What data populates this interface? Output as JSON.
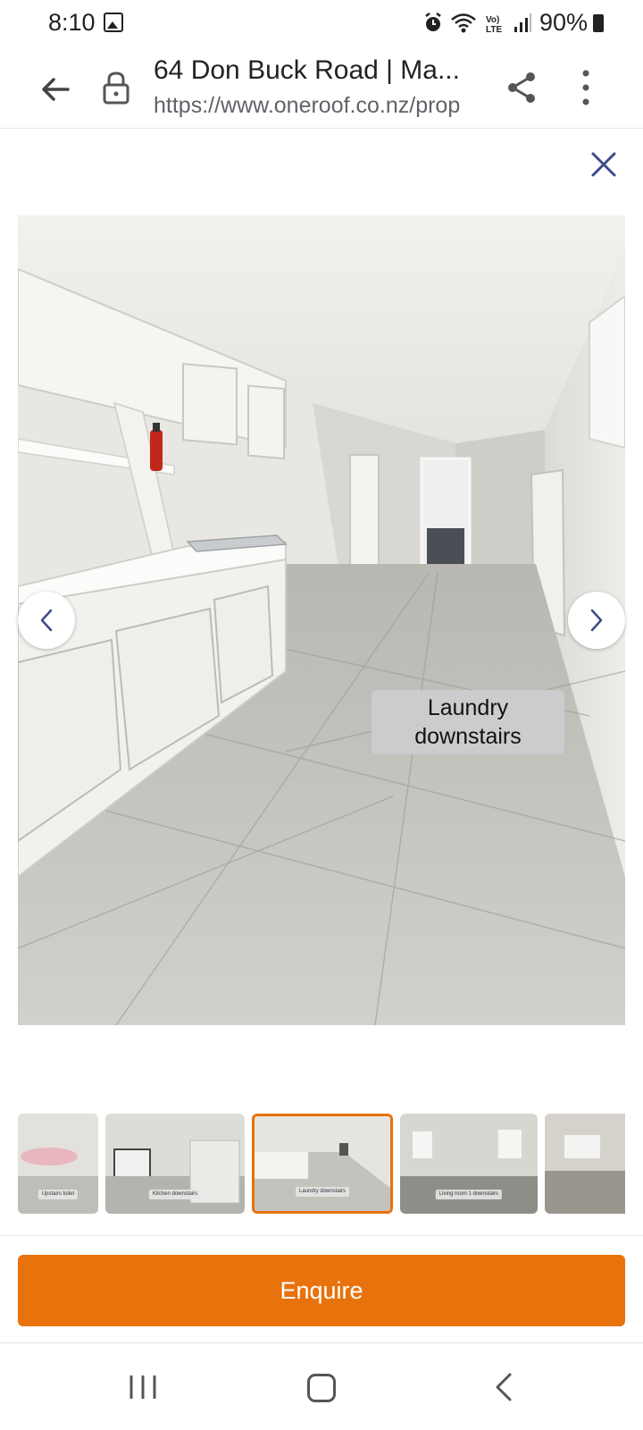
{
  "status_bar": {
    "time": "8:10",
    "battery": "90%",
    "icons": [
      "image-icon",
      "alarm-icon",
      "wifi-icon",
      "volte-icon",
      "signal-icon",
      "battery-icon"
    ]
  },
  "browser": {
    "title": "64 Don Buck Road | Ma...",
    "url": "https://www.oneroof.co.nz/prop"
  },
  "viewer": {
    "caption": "Laundry downstairs",
    "thumbnails": [
      {
        "label": "Upstairs toilet",
        "active": false
      },
      {
        "label": "Kitchen downstairs",
        "active": false
      },
      {
        "label": "Laundry downstairs",
        "active": true
      },
      {
        "label": "Living room 1 downstairs",
        "active": false
      },
      {
        "label": "",
        "active": false
      }
    ]
  },
  "actions": {
    "enquire_label": "Enquire"
  },
  "colors": {
    "accent": "#e8720c",
    "close_icon": "#3c4a8a"
  }
}
